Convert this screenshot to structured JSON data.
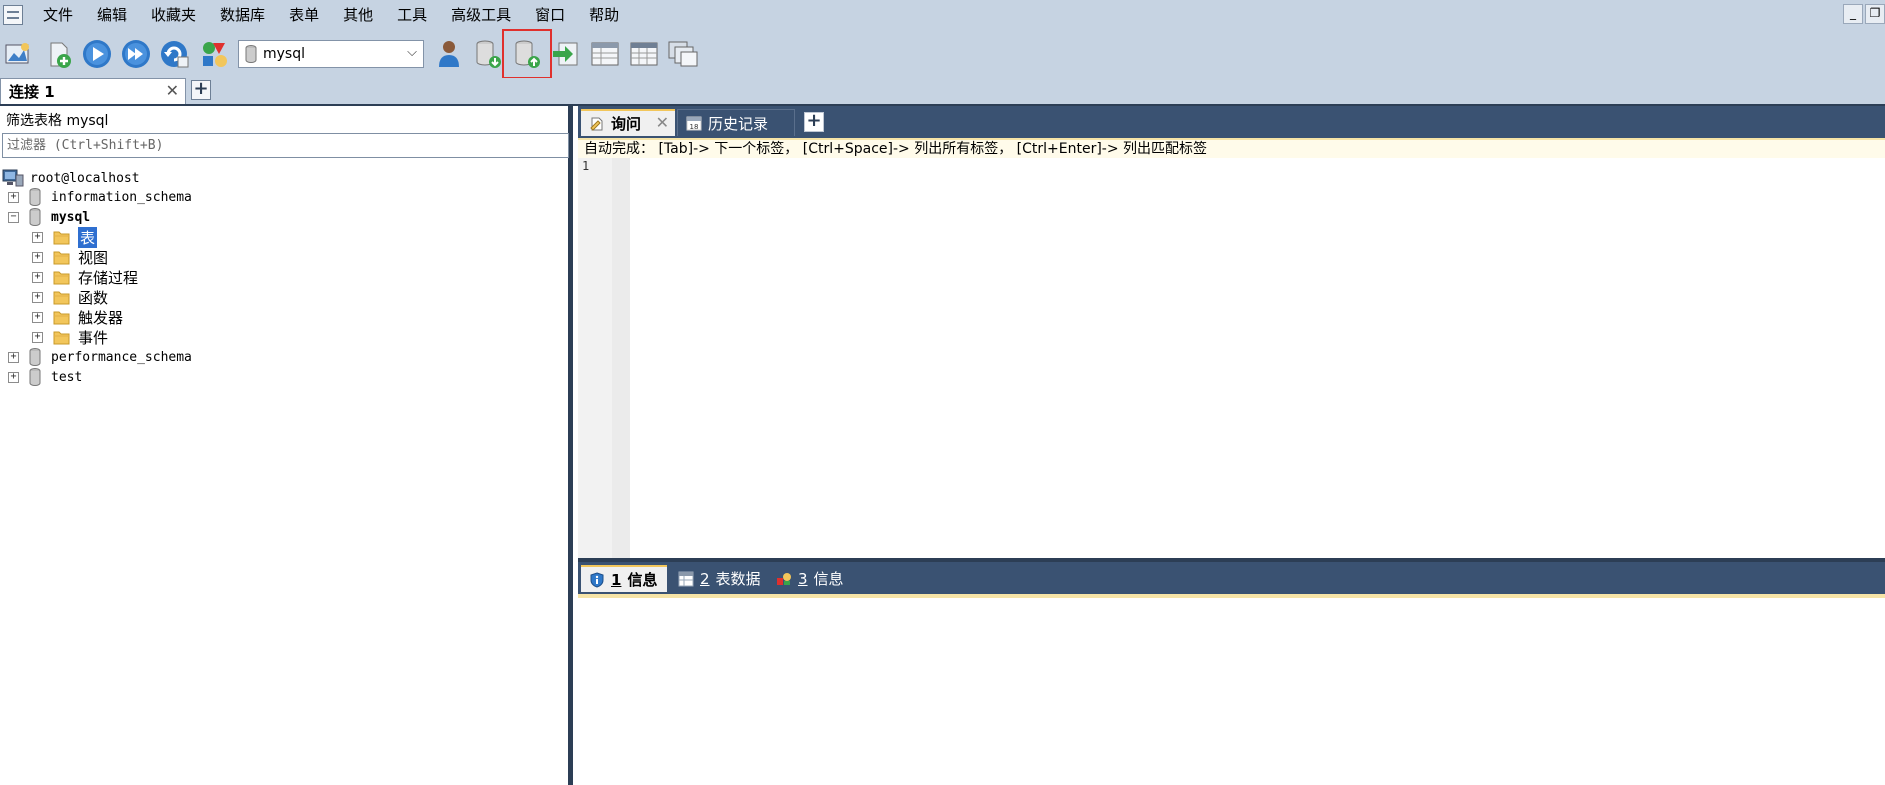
{
  "menu": {
    "items": [
      "文件",
      "编辑",
      "收藏夹",
      "数据库",
      "表单",
      "其他",
      "工具",
      "高级工具",
      "窗口",
      "帮助"
    ]
  },
  "window_controls": {
    "minimize": "_",
    "restore": "❐"
  },
  "toolbar": {
    "database_select": "mysql",
    "dropdown_arrow": "⌵"
  },
  "connection_tabs": {
    "active_label": "连接 1",
    "close": "✕",
    "add": "+"
  },
  "left_panel": {
    "filter_label": "筛选表格 mysql",
    "filter_placeholder": "过滤器 (Ctrl+Shift+B)",
    "tree": {
      "root": "root@localhost",
      "databases": [
        {
          "name": "information_schema",
          "expander": "+"
        },
        {
          "name": "mysql",
          "expander": "−",
          "children": [
            "表",
            "视图",
            "存储过程",
            "函数",
            "触发器",
            "事件"
          ],
          "child_expander": "+"
        },
        {
          "name": "performance_schema",
          "expander": "+"
        },
        {
          "name": "test",
          "expander": "+"
        }
      ]
    }
  },
  "query_tabs": {
    "query": "询问",
    "close": "✕",
    "history": "历史记录",
    "add": "+"
  },
  "hint": "自动完成： [Tab]-> 下一个标签， [Ctrl+Space]-> 列出所有标签， [Ctrl+Enter]-> 列出匹配标签",
  "editor": {
    "line_number": "1"
  },
  "result_tabs": [
    {
      "num": "1",
      "label": "信息"
    },
    {
      "num": "2",
      "label": "表数据"
    },
    {
      "num": "3",
      "label": "信息"
    }
  ],
  "colors": {
    "chrome": "#c6d3e2",
    "dark_panel": "#3a5272",
    "splitter": "#2c3e55",
    "hint_bg": "#fffbea",
    "selection": "#2f6fd0",
    "highlight_box": "#e0302d"
  }
}
